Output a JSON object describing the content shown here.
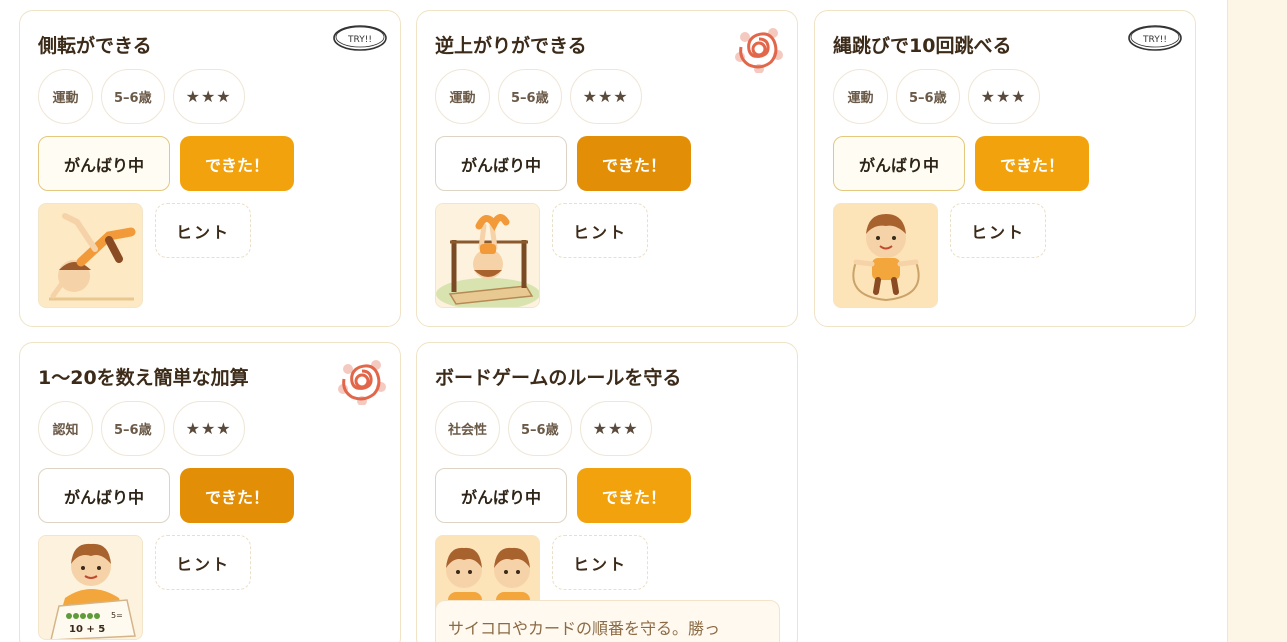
{
  "cards": [
    {
      "title": "側転ができる",
      "tags": [
        "運動",
        "5–6歳",
        "★★★"
      ],
      "progress_label": "がんばり中",
      "done_label": "できた！",
      "hint_label": "ヒント",
      "badge": "TRY!!",
      "thumb_icon": "cartwheel-child-illustration"
    },
    {
      "title": "逆上がりができる",
      "tags": [
        "運動",
        "5–6歳",
        "★★★"
      ],
      "progress_label": "がんばり中",
      "done_label": "できた！",
      "hint_label": "ヒント",
      "badge_icon": "hanamaru-stamp",
      "thumb_icon": "bar-flip-child-illustration"
    },
    {
      "title": "縄跳びで10回跳べる",
      "tags": [
        "運動",
        "5–6歳",
        "★★★"
      ],
      "progress_label": "がんばり中",
      "done_label": "できた！",
      "hint_label": "ヒント",
      "badge": "TRY!!",
      "thumb_icon": "jump-rope-child-illustration"
    },
    {
      "title": "1〜20を数え簡単な加算",
      "tags": [
        "認知",
        "5–6歳",
        "★★★"
      ],
      "progress_label": "がんばり中",
      "done_label": "できた！",
      "hint_label": "ヒント",
      "badge_icon": "hanamaru-stamp",
      "thumb_icon": "counting-child-illustration",
      "thumb_text": "5=\n10 + 5"
    },
    {
      "title": "ボードゲームのルールを守る",
      "tags": [
        "社会性",
        "5–6歳",
        "★★★"
      ],
      "progress_label": "がんばり中",
      "done_label": "できた！",
      "hint_label": "ヒント",
      "thumb_icon": "two-children-illustration",
      "hint_text": "サイコロやカードの順番を守る。勝っ"
    }
  ],
  "colors": {
    "accent": "#f2a20c",
    "accent_dark": "#e38e07",
    "badge_red": "#e2664a",
    "card_border": "#f0e3c6",
    "sidebar_bg": "#fdf6e6"
  }
}
